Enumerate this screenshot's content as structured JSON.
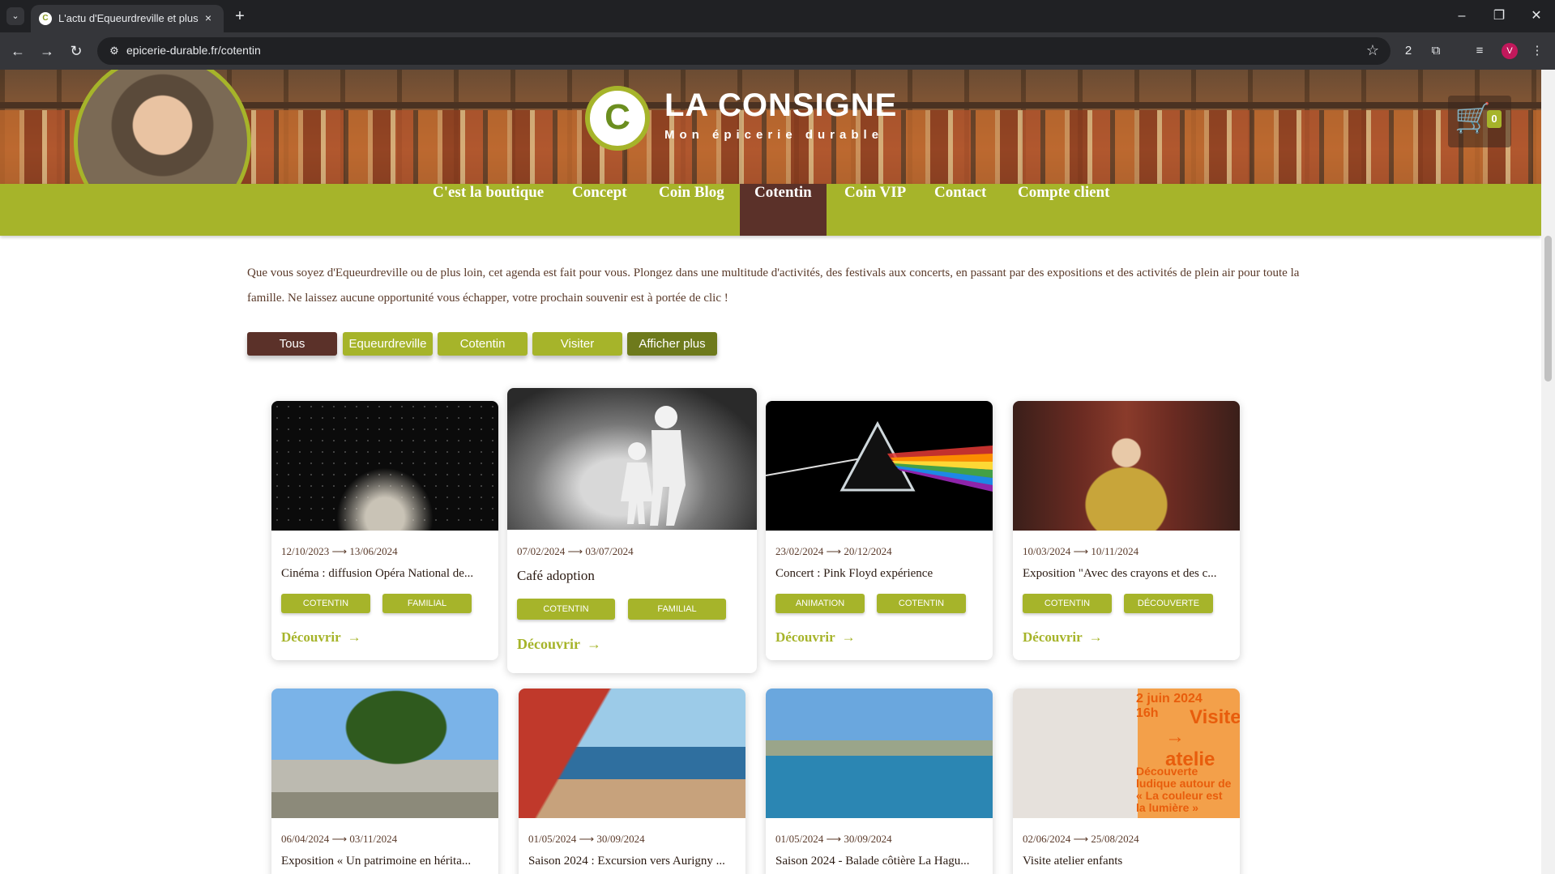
{
  "browser": {
    "tab_title": "L'actu d'Equeurdreville et plus l",
    "tab_favicon": "C",
    "tab_close": "×",
    "new_tab": "+",
    "tab_menu": "⌄",
    "url": "epicerie-durable.fr/cotentin",
    "profile_initial": "V",
    "minimize": "–",
    "restore": "❐",
    "close": "✕",
    "back": "←",
    "forward": "→",
    "reload": "↻",
    "site_info": "⚙",
    "star": "☆",
    "extensions": "⧉",
    "media": "≡",
    "menu": "⋮",
    "ext_badge": "2"
  },
  "header": {
    "brand_name": "LA CONSIGNE",
    "brand_tagline": "Mon épicerie durable",
    "logo_letter": "C",
    "cart_count": "0",
    "cart_icon": "🛒"
  },
  "nav": {
    "items": [
      {
        "label": "C'est la boutique"
      },
      {
        "label": "Concept"
      },
      {
        "label": "Coin Blog"
      },
      {
        "label": "Cotentin",
        "active": true
      },
      {
        "label": "Coin VIP"
      },
      {
        "label": "Contact"
      },
      {
        "label": "Compte client"
      }
    ]
  },
  "intro": "Que vous soyez d'Equeurdreville ou de plus loin, cet agenda est fait pour vous. Plongez dans une multitude d'activités, des festivals aux concerts, en passant par des expositions et des activités de plein air pour toute la famille. Ne laissez aucune opportunité vous échapper, votre prochain souvenir est à portée de clic !",
  "filters": [
    {
      "label": "Tous",
      "color": "#5b3129"
    },
    {
      "label": "Equeurdreville",
      "color": "#a6b42a"
    },
    {
      "label": "Cotentin",
      "color": "#a6b42a"
    },
    {
      "label": "Visiter",
      "color": "#a6b42a"
    },
    {
      "label": "Afficher plus",
      "color": "#6e7a1c"
    }
  ],
  "cards": [
    {
      "dates": "12/10/2023 ⟶ 13/06/2024",
      "title": "Cinéma : diffusion Opéra National de...",
      "tags": [
        "COTENTIN",
        "FAMILIAL"
      ],
      "cta": "Découvrir",
      "image": "ballet-stage"
    },
    {
      "dates": "07/02/2024 ⟶ 03/07/2024",
      "title": "Café adoption",
      "tags": [
        "COTENTIN",
        "FAMILIAL"
      ],
      "cta": "Découvrir",
      "image": "paper-family-hand"
    },
    {
      "dates": "23/02/2024 ⟶ 20/12/2024",
      "title": "Concert : Pink Floyd expérience",
      "tags": [
        "ANIMATION",
        "COTENTIN"
      ],
      "cta": "Découvrir",
      "image": "prism"
    },
    {
      "dates": "10/03/2024 ⟶ 10/11/2024",
      "title": "Exposition \"Avec des crayons et des c...",
      "tags": [
        "COTENTIN",
        "DÉCOUVERTE"
      ],
      "cta": "Découvrir",
      "image": "puppets"
    },
    {
      "dates": "06/04/2024 ⟶ 03/11/2024",
      "title": "Exposition « Un patrimoine en hérita...",
      "tags": [],
      "cta": "",
      "image": "tree-fort"
    },
    {
      "dates": "01/05/2024 ⟶ 30/09/2024",
      "title": "Saison 2024 : Excursion vers Aurigny ...",
      "tags": [],
      "cta": "",
      "image": "sailboat-red"
    },
    {
      "dates": "01/05/2024 ⟶ 30/09/2024",
      "title": "Saison 2024 - Balade côtière La Hagu...",
      "tags": [],
      "cta": "",
      "image": "coast-sail"
    },
    {
      "dates": "02/06/2024 ⟶ 25/08/2024",
      "title": "Visite atelier enfants",
      "tags": [],
      "cta": "",
      "image": "atelier-poster",
      "poster": {
        "date": "2 juin 2024",
        "time": "16h",
        "headline_1": "Visite",
        "headline_2": "→ atelie",
        "body_1": "Découverte",
        "body_2": "ludique autour de",
        "body_3": "« La couleur est",
        "body_4": "la lumière »"
      }
    }
  ],
  "arrow": "→"
}
